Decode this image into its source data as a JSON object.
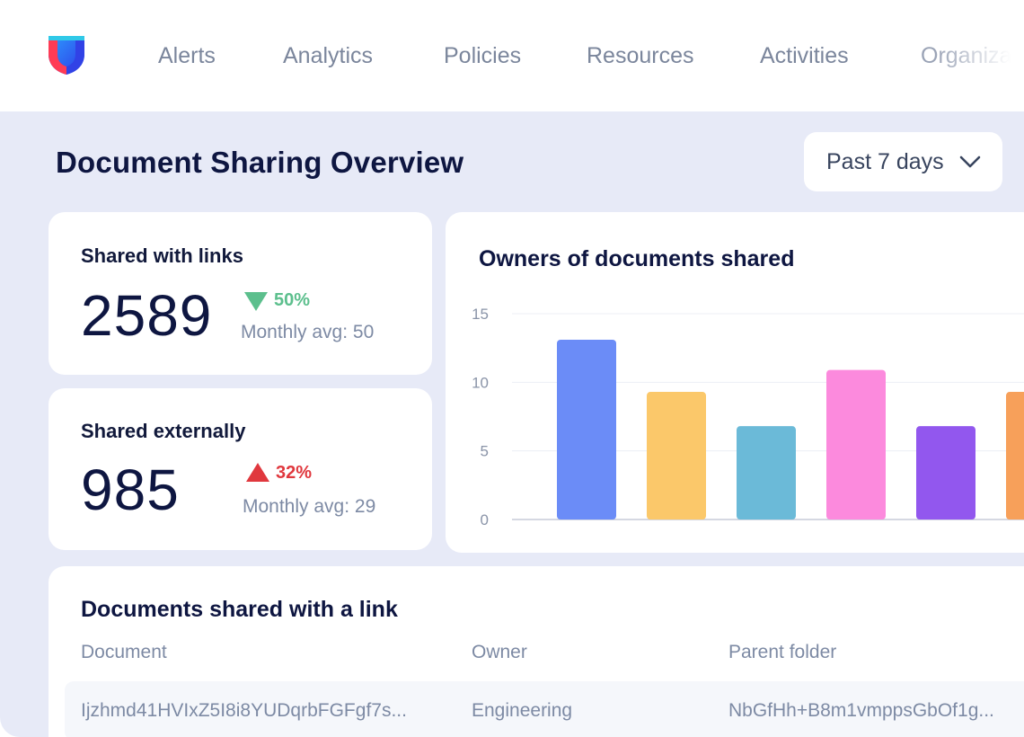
{
  "header": {
    "logo_icon": "shield-logo-icon",
    "nav": [
      {
        "label": "Alerts",
        "key": "alerts"
      },
      {
        "label": "Analytics",
        "key": "analytics"
      },
      {
        "label": "Policies",
        "key": "policies"
      },
      {
        "label": "Resources",
        "key": "resources"
      },
      {
        "label": "Activities",
        "key": "activities"
      },
      {
        "label": "Organizat",
        "key": "organization"
      }
    ]
  },
  "page": {
    "title": "Document Sharing Overview",
    "range_select": {
      "value": "Past 7 days",
      "icon": "chevron-down-icon"
    }
  },
  "stats": {
    "links": {
      "title": "Shared with links",
      "value": "2589",
      "change": "50%",
      "direction": "down",
      "color": "#5cbf8d",
      "avg": "Monthly avg: 50"
    },
    "external": {
      "title": "Shared externally",
      "value": "985",
      "change": "32%",
      "direction": "up",
      "color": "#e0383e",
      "avg": "Monthly avg: 29"
    }
  },
  "chart": {
    "title": "Owners of documents shared"
  },
  "chart_data": {
    "type": "bar",
    "title": "Owners of documents shared",
    "categories": [
      "",
      "",
      "",
      "",
      "",
      ""
    ],
    "values": [
      13.1,
      9.3,
      6.8,
      10.9,
      6.8,
      9.3
    ],
    "colors": [
      "#6b8cf7",
      "#fbc86a",
      "#6bbad8",
      "#fc8add",
      "#9257ee",
      "#f7a05a"
    ],
    "yticks": [
      0,
      5,
      10,
      15
    ],
    "ylim": [
      0,
      15
    ],
    "xlabel": "",
    "ylabel": "",
    "grid": true,
    "legend": "none"
  },
  "table": {
    "title": "Documents shared with a link",
    "columns": {
      "document": "Document",
      "owner": "Owner",
      "folder": "Parent folder"
    },
    "rows": [
      {
        "document": "Ijzhmd41HVIxZ5I8i8YUDqrbFGFgf7s...",
        "owner": "Engineering",
        "folder": "NbGfHh+B8m1vmppsGbOf1g..."
      }
    ]
  }
}
